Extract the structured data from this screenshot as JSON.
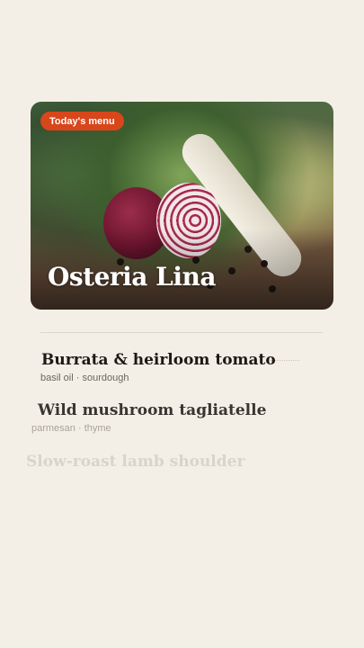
{
  "hero": {
    "badge": "Today's menu",
    "title": "Osteria Lina"
  },
  "dishes": [
    {
      "name": "Burrata & heirloom tomato",
      "desc": "basil oil · sourdough"
    },
    {
      "name": "Wild mushroom tagliatelle",
      "desc": "parmesan · thyme"
    },
    {
      "name": "Slow-roast lamb shoulder"
    }
  ],
  "colors": {
    "background": "#f3efe6",
    "badge": "#d8461c",
    "text": "#1e1915"
  }
}
